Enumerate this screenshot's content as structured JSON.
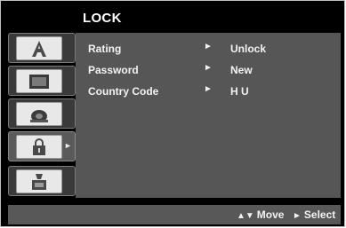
{
  "header": {
    "title": "LOCK"
  },
  "menu": {
    "items": [
      {
        "label": "Rating",
        "arrow": "►",
        "value": "Unlock"
      },
      {
        "label": "Password",
        "arrow": "►",
        "value": "New"
      },
      {
        "label": "Country Code",
        "arrow": "►",
        "value": "H U"
      }
    ]
  },
  "sidebar": {
    "tabs": [
      {
        "icon": "language-a-icon",
        "active": false
      },
      {
        "icon": "screen-icon",
        "active": false
      },
      {
        "icon": "speaker-icon",
        "active": false
      },
      {
        "icon": "lock-icon",
        "active": true,
        "pointer": "►"
      },
      {
        "icon": "other-settings-icon",
        "active": false
      }
    ]
  },
  "footer": {
    "move_glyph": "▲▼",
    "move_label": "Move",
    "select_glyph": "►",
    "select_label": "Select"
  },
  "colors": {
    "background": "#000000",
    "panel": "#565656",
    "text": "#f2f2f2"
  }
}
